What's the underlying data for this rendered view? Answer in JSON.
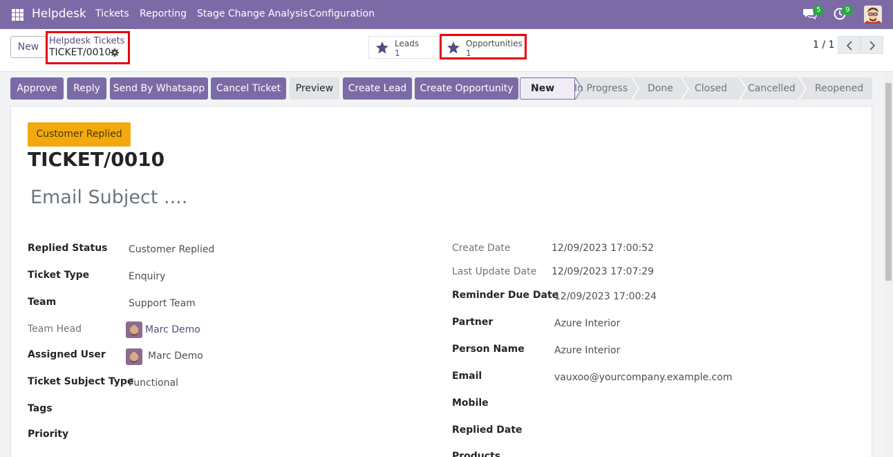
{
  "nav": {
    "brand": "Helpdesk",
    "menu": [
      "Tickets",
      "Reporting",
      "Stage Change Analysis",
      "Configuration"
    ],
    "chat_count": "5",
    "activity_count": "9"
  },
  "control": {
    "new_label": "New",
    "breadcrumb_parent": "Helpdesk Tickets",
    "breadcrumb_current": "TICKET/0010",
    "leads_label": "Leads",
    "leads_value": "1",
    "opps_label": "Opportunities",
    "opps_value": "1",
    "pager": "1 / 1"
  },
  "actions": [
    "Approve",
    "Reply",
    "Send By Whatsapp",
    "Cancel Ticket",
    "Preview",
    "Create Lead",
    "Create Opportunity"
  ],
  "stages": [
    "New",
    "In Progress",
    "Done",
    "Closed",
    "Cancelled",
    "Reopened"
  ],
  "form": {
    "status": "Customer Replied",
    "title": "TICKET/0010",
    "subject_placeholder": "Email Subject ....",
    "left": {
      "replied_status_label": "Replied Status",
      "replied_status": "Customer Replied",
      "ticket_type_label": "Ticket Type",
      "ticket_type": "Enquiry",
      "team_label": "Team",
      "team": "Support Team",
      "team_head_label": "Team Head",
      "team_head": "Marc Demo",
      "assigned_user_label": "Assigned User",
      "assigned_user": "Marc Demo",
      "subject_type_label": "Ticket Subject Type",
      "subject_type": "Functional",
      "tags_label": "Tags",
      "priority_label": "Priority"
    },
    "right": {
      "create_date_label": "Create Date",
      "create_date": "12/09/2023 17:00:52",
      "last_update_label": "Last Update Date",
      "last_update": "12/09/2023 17:07:29",
      "reminder_label": "Reminder Due Date",
      "reminder": "12/09/2023 17:00:24",
      "partner_label": "Partner",
      "partner": "Azure Interior",
      "person_label": "Person Name",
      "person": "Azure Interior",
      "email_label": "Email",
      "email": "vauxoo@yourcompany.example.com",
      "mobile_label": "Mobile",
      "replied_date_label": "Replied Date",
      "products_label": "Products"
    }
  }
}
